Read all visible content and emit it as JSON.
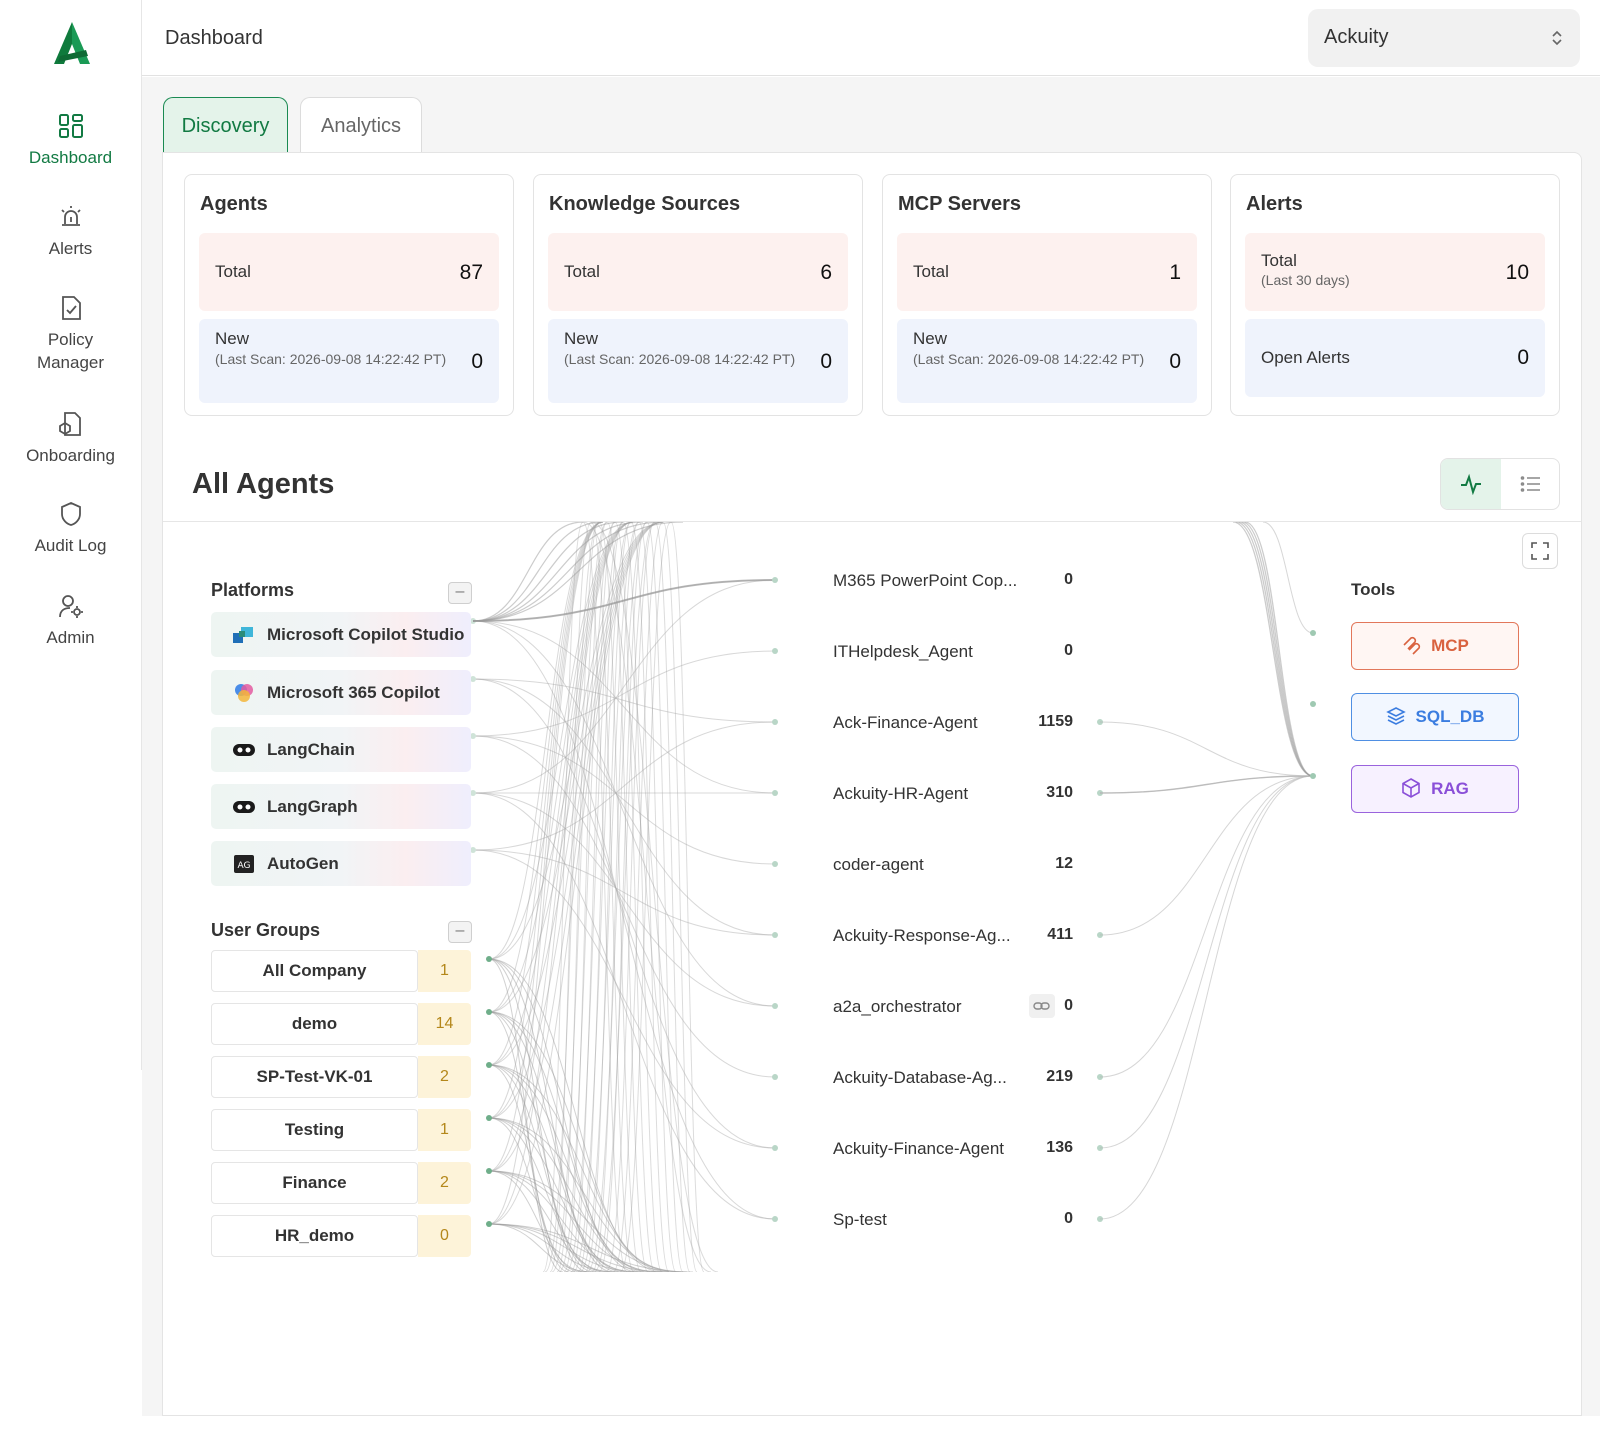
{
  "header": {
    "page_title": "Dashboard",
    "org_selector": "Ackuity"
  },
  "sidebar": {
    "items": [
      {
        "label": "Dashboard",
        "icon": "dashboard-grid-icon",
        "active": true
      },
      {
        "label": "Alerts",
        "icon": "alarm-icon"
      },
      {
        "label": "Policy\nManager",
        "icon": "document-check-icon"
      },
      {
        "label": "Onboarding",
        "icon": "onboarding-document-icon"
      },
      {
        "label": "Audit Log",
        "icon": "shield-icon"
      },
      {
        "label": "Admin",
        "icon": "user-gear-icon"
      }
    ]
  },
  "tabs": [
    {
      "label": "Discovery",
      "active": true
    },
    {
      "label": "Analytics"
    }
  ],
  "cards": {
    "agents": {
      "title": "Agents",
      "total_label": "Total",
      "total": "87",
      "new_label": "New",
      "new_sub": "(Last Scan: 2026-09-08 14:22:42 PT)",
      "new": "0"
    },
    "knowledge": {
      "title": "Knowledge Sources",
      "total_label": "Total",
      "total": "6",
      "new_label": "New",
      "new_sub": "(Last Scan: 2026-09-08 14:22:42 PT)",
      "new": "0"
    },
    "mcp": {
      "title": "MCP Servers",
      "total_label": "Total",
      "total": "1",
      "new_label": "New",
      "new_sub": "(Last Scan: 2026-09-08 14:22:42 PT)",
      "new": "0"
    },
    "alerts": {
      "title": "Alerts",
      "total_label": "Total",
      "total_sub": "(Last 30 days)",
      "total": "10",
      "open_label": "Open Alerts",
      "open": "0"
    }
  },
  "all_agents": {
    "title": "All Agents",
    "platforms_heading": "Platforms",
    "platforms": [
      "Microsoft Copilot Studio",
      "Microsoft 365 Copilot",
      "LangChain",
      "LangGraph",
      "AutoGen"
    ],
    "user_groups_heading": "User Groups",
    "user_groups": [
      {
        "name": "All Company",
        "count": "1"
      },
      {
        "name": "demo",
        "count": "14"
      },
      {
        "name": "SP-Test-VK-01",
        "count": "2"
      },
      {
        "name": "Testing",
        "count": "1"
      },
      {
        "name": "Finance",
        "count": "2"
      },
      {
        "name": "HR_demo",
        "count": "0"
      }
    ],
    "agents": [
      {
        "name": "M365 PowerPoint Cop...",
        "count": "0"
      },
      {
        "name": "ITHelpdesk_Agent",
        "count": "0"
      },
      {
        "name": "Ack-Finance-Agent",
        "count": "1159"
      },
      {
        "name": "Ackuity-HR-Agent",
        "count": "310"
      },
      {
        "name": "coder-agent",
        "count": "12"
      },
      {
        "name": "Ackuity-Response-Ag...",
        "count": "411"
      },
      {
        "name": "a2a_orchestrator",
        "count": "0"
      },
      {
        "name": "Ackuity-Database-Ag...",
        "count": "219"
      },
      {
        "name": "Ackuity-Finance-Agent",
        "count": "136"
      },
      {
        "name": "Sp-test",
        "count": "0"
      }
    ],
    "tools_heading": "Tools",
    "tools": [
      {
        "name": "MCP"
      },
      {
        "name": "SQL_DB"
      },
      {
        "name": "RAG"
      }
    ]
  },
  "colors": {
    "brand_green": "#127a43",
    "mcp": "#d9623f",
    "sql": "#3b7de0",
    "rag": "#8a4fd8"
  }
}
